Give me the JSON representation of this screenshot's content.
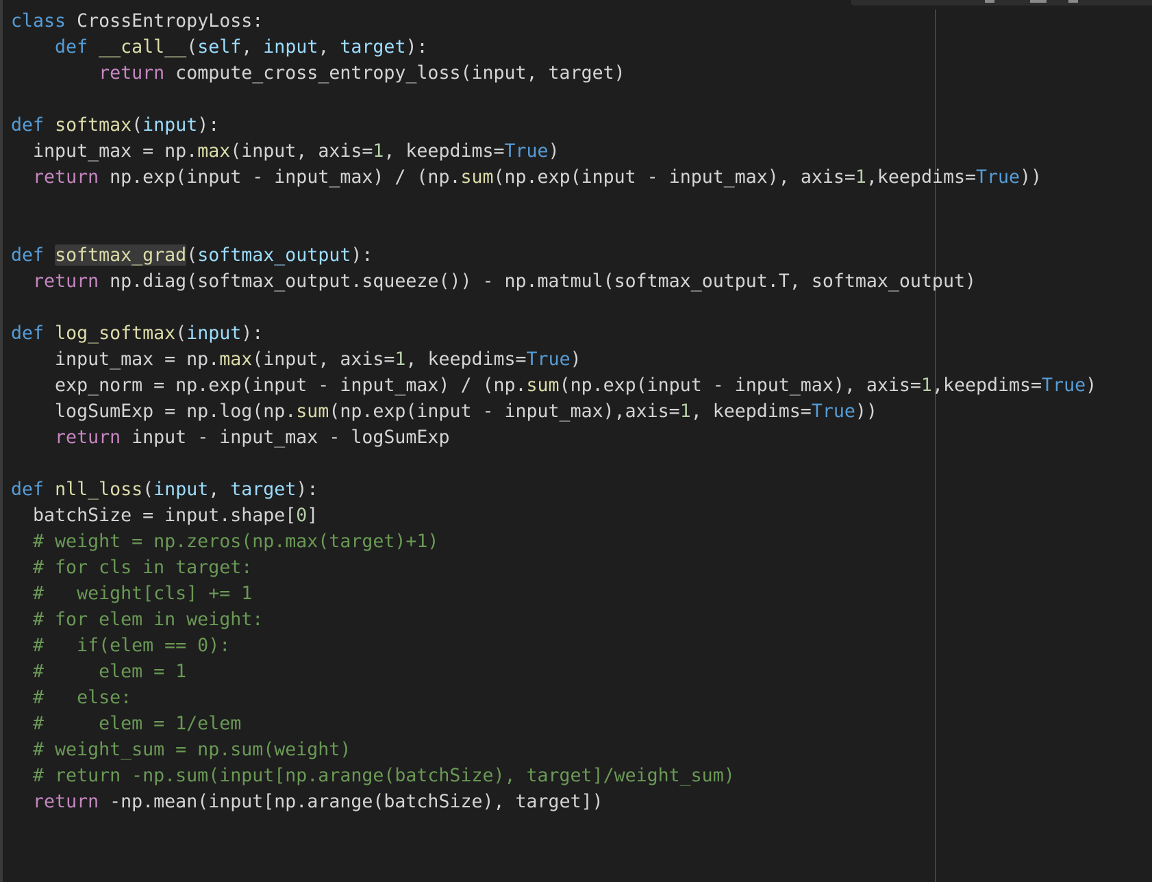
{
  "editor": {
    "lines": [
      [
        {
          "t": "class",
          "c": "keyword"
        },
        {
          "t": " CrossEntropyLoss:",
          "c": "plain"
        }
      ],
      [
        {
          "t": "    ",
          "c": "plain"
        },
        {
          "t": "def",
          "c": "keyword"
        },
        {
          "t": " ",
          "c": "plain"
        },
        {
          "t": "__call__",
          "c": "function"
        },
        {
          "t": "(",
          "c": "plain"
        },
        {
          "t": "self",
          "c": "param"
        },
        {
          "t": ", ",
          "c": "plain"
        },
        {
          "t": "input",
          "c": "param"
        },
        {
          "t": ", ",
          "c": "plain"
        },
        {
          "t": "target",
          "c": "param"
        },
        {
          "t": "):",
          "c": "plain"
        }
      ],
      [
        {
          "t": "        ",
          "c": "plain"
        },
        {
          "t": "return",
          "c": "control"
        },
        {
          "t": " compute_cross_entropy_loss(input, target)",
          "c": "plain"
        }
      ],
      [],
      [
        {
          "t": "def",
          "c": "keyword"
        },
        {
          "t": " ",
          "c": "plain"
        },
        {
          "t": "softmax",
          "c": "function"
        },
        {
          "t": "(",
          "c": "plain"
        },
        {
          "t": "input",
          "c": "param"
        },
        {
          "t": "):",
          "c": "plain"
        }
      ],
      [
        {
          "t": "  input_max = np.",
          "c": "plain"
        },
        {
          "t": "max",
          "c": "function"
        },
        {
          "t": "(input, axis=",
          "c": "plain"
        },
        {
          "t": "1",
          "c": "number"
        },
        {
          "t": ", keepdims=",
          "c": "plain"
        },
        {
          "t": "True",
          "c": "bool"
        },
        {
          "t": ")",
          "c": "plain"
        }
      ],
      [
        {
          "t": "  ",
          "c": "plain"
        },
        {
          "t": "return",
          "c": "control"
        },
        {
          "t": " np.exp(input - input_max) / (np.",
          "c": "plain"
        },
        {
          "t": "sum",
          "c": "function"
        },
        {
          "t": "(np.exp(input - input_max), axis=",
          "c": "plain"
        },
        {
          "t": "1",
          "c": "number"
        },
        {
          "t": ",keepdims=",
          "c": "plain"
        },
        {
          "t": "True",
          "c": "bool"
        },
        {
          "t": "))",
          "c": "plain"
        }
      ],
      [],
      [],
      [
        {
          "t": "def",
          "c": "keyword"
        },
        {
          "t": " ",
          "c": "plain"
        },
        {
          "t": "softmax_grad",
          "c": "function highlight"
        },
        {
          "t": "(",
          "c": "plain"
        },
        {
          "t": "softmax_output",
          "c": "param"
        },
        {
          "t": "):",
          "c": "plain"
        }
      ],
      [
        {
          "t": "  ",
          "c": "plain"
        },
        {
          "t": "return",
          "c": "control"
        },
        {
          "t": " np.diag(softmax_output.squeeze()) - np.matmul(softmax_output.T, softmax_output)",
          "c": "plain"
        }
      ],
      [],
      [
        {
          "t": "def",
          "c": "keyword"
        },
        {
          "t": " ",
          "c": "plain"
        },
        {
          "t": "log_softmax",
          "c": "function"
        },
        {
          "t": "(",
          "c": "plain"
        },
        {
          "t": "input",
          "c": "param"
        },
        {
          "t": "):",
          "c": "plain"
        }
      ],
      [
        {
          "t": "    input_max = np.",
          "c": "plain"
        },
        {
          "t": "max",
          "c": "function"
        },
        {
          "t": "(input, axis=",
          "c": "plain"
        },
        {
          "t": "1",
          "c": "number"
        },
        {
          "t": ", keepdims=",
          "c": "plain"
        },
        {
          "t": "True",
          "c": "bool"
        },
        {
          "t": ")",
          "c": "plain"
        }
      ],
      [
        {
          "t": "    exp_norm = np.exp(input - input_max) / (np.",
          "c": "plain"
        },
        {
          "t": "sum",
          "c": "function"
        },
        {
          "t": "(np.exp(input - input_max), axis=",
          "c": "plain"
        },
        {
          "t": "1",
          "c": "number"
        },
        {
          "t": ",keepdims=",
          "c": "plain"
        },
        {
          "t": "True",
          "c": "bool"
        },
        {
          "t": ")",
          "c": "plain"
        }
      ],
      [
        {
          "t": "    logSumExp = np.log(np.",
          "c": "plain"
        },
        {
          "t": "sum",
          "c": "function"
        },
        {
          "t": "(np.exp(input - input_max),axis=",
          "c": "plain"
        },
        {
          "t": "1",
          "c": "number"
        },
        {
          "t": ", keepdims=",
          "c": "plain"
        },
        {
          "t": "True",
          "c": "bool"
        },
        {
          "t": "))",
          "c": "plain"
        }
      ],
      [
        {
          "t": "    ",
          "c": "plain"
        },
        {
          "t": "return",
          "c": "control"
        },
        {
          "t": " input - input_max - logSumExp",
          "c": "plain"
        }
      ],
      [],
      [
        {
          "t": "def",
          "c": "keyword"
        },
        {
          "t": " ",
          "c": "plain"
        },
        {
          "t": "nll_loss",
          "c": "function"
        },
        {
          "t": "(",
          "c": "plain"
        },
        {
          "t": "input",
          "c": "param"
        },
        {
          "t": ", ",
          "c": "plain"
        },
        {
          "t": "target",
          "c": "param"
        },
        {
          "t": "):",
          "c": "plain"
        }
      ],
      [
        {
          "t": "  batchSize = input.shape[",
          "c": "plain"
        },
        {
          "t": "0",
          "c": "number"
        },
        {
          "t": "]",
          "c": "plain"
        }
      ],
      [
        {
          "t": "  # weight = np.zeros(np.max(target)+1)",
          "c": "comment"
        }
      ],
      [
        {
          "t": "  # for cls in target:",
          "c": "comment"
        }
      ],
      [
        {
          "t": "  #   weight[cls] += 1",
          "c": "comment"
        }
      ],
      [
        {
          "t": "  # for elem in weight:",
          "c": "comment"
        }
      ],
      [
        {
          "t": "  #   if(elem == 0):",
          "c": "comment"
        }
      ],
      [
        {
          "t": "  #     elem = 1",
          "c": "comment"
        }
      ],
      [
        {
          "t": "  #   else:",
          "c": "comment"
        }
      ],
      [
        {
          "t": "  #     elem = 1/elem",
          "c": "comment"
        }
      ],
      [
        {
          "t": "  # weight_sum = np.sum(weight)",
          "c": "comment"
        }
      ],
      [
        {
          "t": "  # return -np.sum(input[np.arange(batchSize), target]/weight_sum)",
          "c": "comment"
        }
      ],
      [
        {
          "t": "  ",
          "c": "plain"
        },
        {
          "t": "return",
          "c": "control"
        },
        {
          "t": " -np.mean(input[np.arange(batchSize), target])",
          "c": "plain"
        }
      ]
    ]
  }
}
